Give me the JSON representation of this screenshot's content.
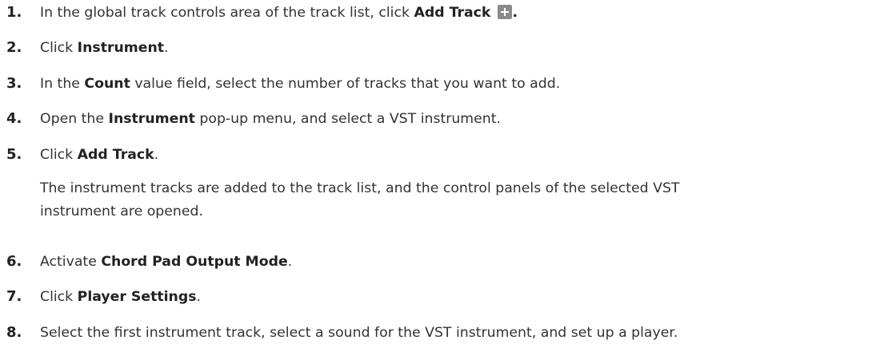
{
  "steps": [
    {
      "num": "1.",
      "pre": "In the global track controls area of the track list, click ",
      "bold": "Add Track",
      "icon": "plus-icon",
      "post": "."
    },
    {
      "num": "2.",
      "pre": "Click ",
      "bold": "Instrument",
      "post": "."
    },
    {
      "num": "3.",
      "pre": "In the ",
      "bold": "Count",
      "post": " value field, select the number of tracks that you want to add."
    },
    {
      "num": "4.",
      "pre": "Open the ",
      "bold": "Instrument",
      "post": " pop-up menu, and select a VST instrument."
    },
    {
      "num": "5.",
      "pre": "Click ",
      "bold": "Add Track",
      "post": ".",
      "result_line1": "The instrument tracks are added to the track list, and the control panels of the selected VST",
      "result_line2": "instrument are opened."
    },
    {
      "num": "6.",
      "pre": "Activate ",
      "bold": "Chord Pad Output Mode",
      "post": "."
    },
    {
      "num": "7.",
      "pre": "Click ",
      "bold": "Player Settings",
      "post": "."
    },
    {
      "num": "8.",
      "text": "Select the first instrument track, select a sound for the VST instrument, and set up a player."
    }
  ]
}
